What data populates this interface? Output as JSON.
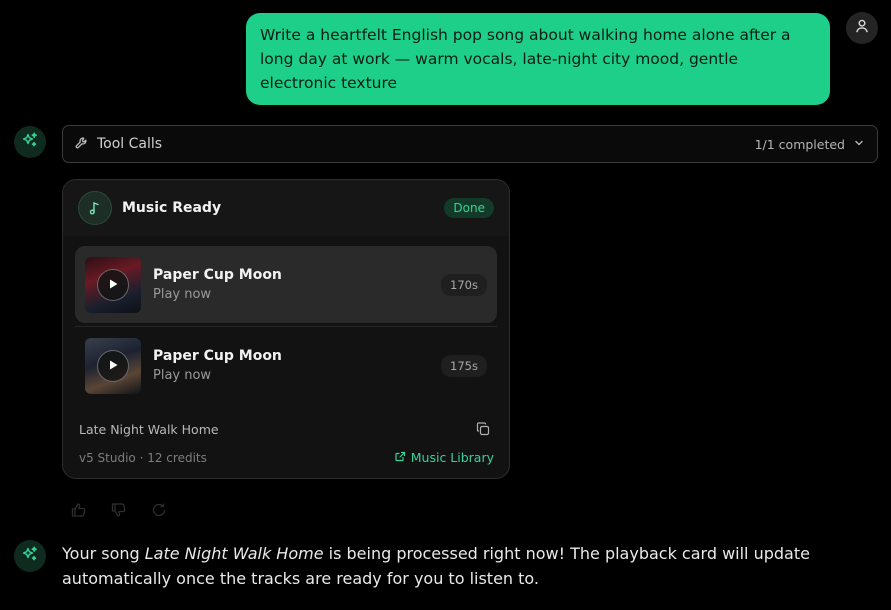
{
  "user_message": {
    "text": "Write a heartfelt English pop song about walking home alone after a long day at work — warm vocals, late-night city mood, gentle electronic texture",
    "avatar_icon": "user-icon"
  },
  "tool_calls": {
    "label": "Tool Calls",
    "status": "1/1 completed",
    "icon": "wrench-icon"
  },
  "music_card": {
    "title": "Music Ready",
    "badge": "Done",
    "tracks": [
      {
        "title": "Paper Cup Moon",
        "subtitle": "Play now",
        "duration": "170s"
      },
      {
        "title": "Paper Cup Moon",
        "subtitle": "Play now",
        "duration": "175s"
      }
    ],
    "song_name": "Late Night Walk Home",
    "meta": "v5 Studio · 12 credits",
    "library_link": "Music Library"
  },
  "bot_message": {
    "prefix": "Your song ",
    "song": "Late Night Walk Home",
    "suffix": " is being processed right now! The playback card will update automatically once the tracks are ready for you to listen to."
  },
  "colors": {
    "accent": "#34d399",
    "user_bubble": "#1ecf8a",
    "background": "#000000"
  }
}
